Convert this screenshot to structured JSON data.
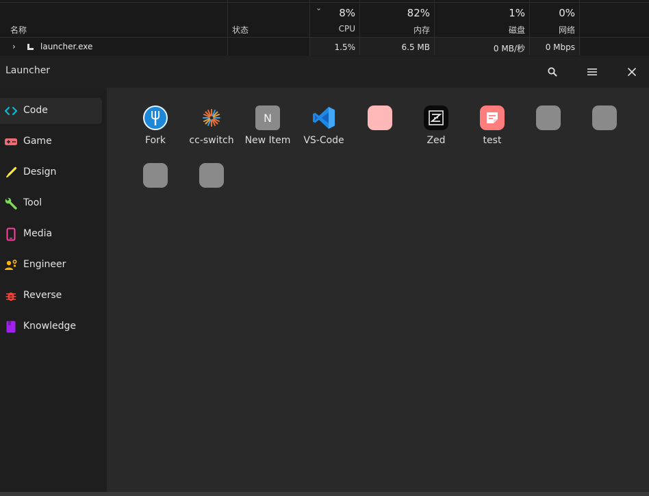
{
  "task_manager": {
    "columns": {
      "name": "名称",
      "status": "状态",
      "cpu": {
        "percent": "8%",
        "label": "CPU"
      },
      "memory": {
        "percent": "82%",
        "label": "内存"
      },
      "disk": {
        "percent": "1%",
        "label": "磁盘"
      },
      "network": {
        "percent": "0%",
        "label": "网络"
      }
    },
    "process": {
      "name": "launcher.exe",
      "cpu": "1.5%",
      "memory": "6.5 MB",
      "disk": "0 MB/秒",
      "network": "0 Mbps"
    }
  },
  "window": {
    "title": "Launcher",
    "buttons": [
      "search-icon",
      "menu-icon",
      "close-icon"
    ]
  },
  "sidebar": {
    "items": [
      {
        "label": "Code",
        "icon": "code-icon",
        "color": "#00bcd4",
        "active": true
      },
      {
        "label": "Game",
        "icon": "gamepad-icon",
        "color": "#ef6b73",
        "active": false
      },
      {
        "label": "Design",
        "icon": "brush-icon",
        "color": "#ffeb3b",
        "active": false
      },
      {
        "label": "Tool",
        "icon": "wrench-icon",
        "color": "#7ed957",
        "active": false
      },
      {
        "label": "Media",
        "icon": "phone-icon",
        "color": "#ff40a0",
        "active": false
      },
      {
        "label": "Engineer",
        "icon": "engineer-icon",
        "color": "#ffb300",
        "active": false
      },
      {
        "label": "Reverse",
        "icon": "bug-icon",
        "color": "#f44336",
        "active": false
      },
      {
        "label": "Knowledge",
        "icon": "book-icon",
        "color": "#a020f0",
        "active": false
      }
    ]
  },
  "apps": [
    {
      "label": "Fork",
      "icon": "fork-icon"
    },
    {
      "label": "cc-switch",
      "icon": "cc-switch-icon"
    },
    {
      "label": "New Item",
      "icon": "letter-n-icon",
      "letter": "N"
    },
    {
      "label": "VS-Code",
      "icon": "vscode-icon"
    },
    {
      "label": "",
      "icon": "blank-pink-icon",
      "color": "#ffb8b8"
    },
    {
      "label": "Zed",
      "icon": "zed-icon"
    },
    {
      "label": "test",
      "icon": "note-icon",
      "color": "#ff7d7d"
    },
    {
      "label": "",
      "icon": "blank-gray-icon",
      "color": "#8a8a8a"
    },
    {
      "label": "",
      "icon": "blank-gray-icon",
      "color": "#8a8a8a"
    },
    {
      "label": "",
      "icon": "blank-gray-icon",
      "color": "#8a8a8a"
    },
    {
      "label": "",
      "icon": "blank-gray-icon",
      "color": "#8a8a8a"
    }
  ]
}
